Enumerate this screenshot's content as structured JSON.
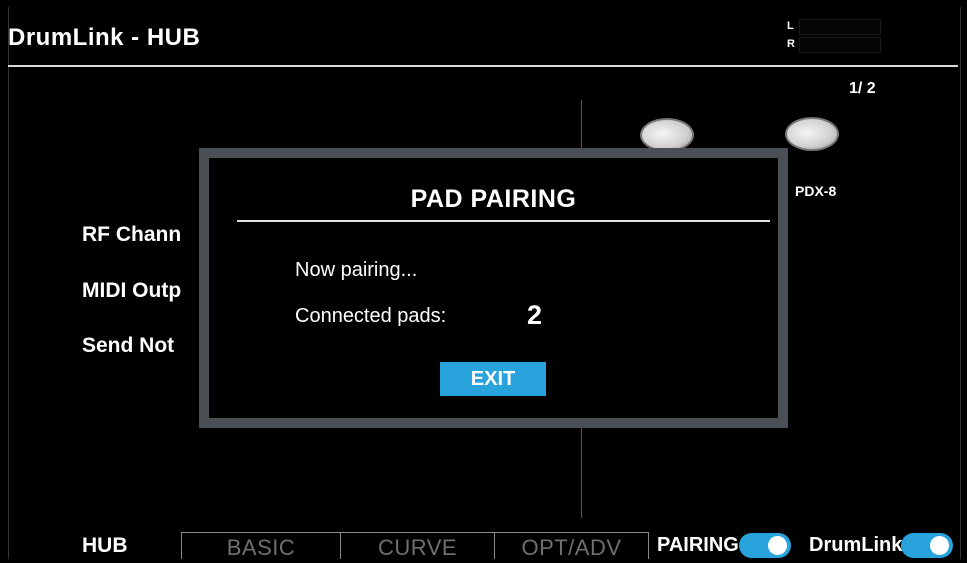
{
  "header": {
    "title": "DrumLink - HUB",
    "meter_left": "L",
    "meter_right": "R"
  },
  "page_indicator": "1/ 2",
  "side_labels": [
    "RF Chann",
    "MIDI Outp",
    "Send Not"
  ],
  "pad": {
    "name": "PDX-8"
  },
  "modal": {
    "title": "PAD PAIRING",
    "status": "Now pairing...",
    "connected_label": "Connected pads:",
    "connected_count": "2",
    "exit_label": "EXIT"
  },
  "bottom_bar": {
    "current": "HUB",
    "tabs": [
      "BASIC",
      "CURVE",
      "OPT/ADV"
    ],
    "toggles": [
      {
        "label": "PAIRING",
        "on": true
      },
      {
        "label": "DrumLink",
        "on": true
      }
    ]
  },
  "colors": {
    "accent": "#29a3dc",
    "modal_border": "#4a4f55",
    "background": "#000000"
  }
}
